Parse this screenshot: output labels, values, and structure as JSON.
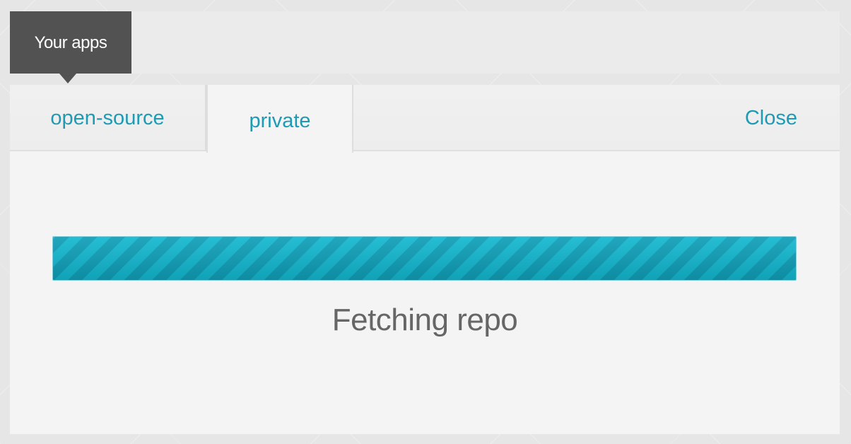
{
  "header": {
    "apps_label": "Your apps"
  },
  "tabs": [
    {
      "label": "open-source",
      "active": false
    },
    {
      "label": "private",
      "active": true
    }
  ],
  "actions": {
    "close_label": "Close"
  },
  "progress": {
    "percent": 100,
    "animated_stripes": true,
    "status_text": "Fetching repo"
  },
  "colors": {
    "accent": "#1e9bb4",
    "progress_stripe_light": "#13b8d0",
    "progress_stripe_dark": "#0f9fb8",
    "dark_tab": "#525252",
    "panel": "#f4f4f4"
  },
  "icons": {
    "apps_pointer": "caret-down-icon"
  }
}
